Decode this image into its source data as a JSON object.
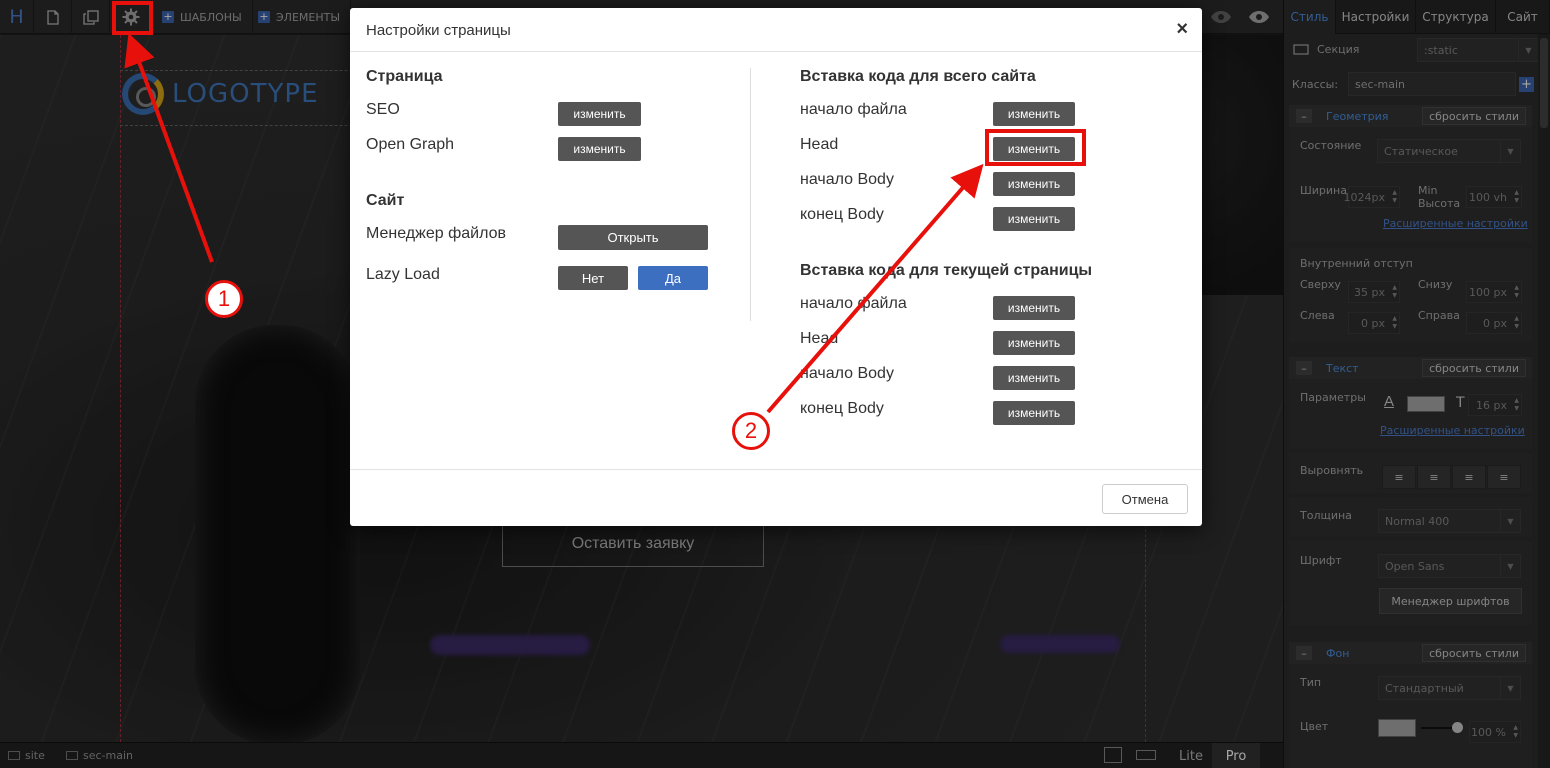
{
  "toolbar": {
    "logo_letter": "H",
    "templates_label": "ШАБЛОНЫ",
    "elements_label": "ЭЛЕМЕНТЫ"
  },
  "canvas": {
    "logo_text": "LOGOTYPE",
    "cta_label": "Оставить заявку"
  },
  "statusbar": {
    "crumb_site": "site",
    "crumb_section": "sec-main",
    "lite_label": "Lite",
    "pro_label": "Pro"
  },
  "panel": {
    "tabs": [
      "Стиль",
      "Настройки",
      "Структура",
      "Сайт"
    ],
    "section_label": "Секция",
    "section_value": ":static",
    "classes_label": "Классы:",
    "classes_value": "sec-main",
    "geometry": {
      "title": "Геометрия",
      "reset": "сбросить стили",
      "state_label": "Состояние",
      "state_value": "Статическое",
      "width_label": "Ширина",
      "width_value": "1024px",
      "minheight_label_1": "Min",
      "minheight_label_2": "Высота",
      "minheight_value": "100 vh",
      "advanced": "Расширенные настройки",
      "padding_label": "Внутренний отступ",
      "top_label": "Сверху",
      "top_value": "35",
      "bottom_label": "Снизу",
      "bottom_value": "100",
      "left_label": "Слева",
      "left_value": "0",
      "right_label": "Справа",
      "right_value": "0",
      "unit": "px"
    },
    "text": {
      "title": "Текст",
      "reset": "сбросить стили",
      "params_label": "Параметры",
      "font_size": "16",
      "unit": "px",
      "advanced": "Расширенные настройки",
      "align_label": "Выровнять",
      "weight_label": "Толщина",
      "weight_value": "Normal 400",
      "font_label": "Шрифт",
      "font_value": "Open Sans",
      "font_manager": "Менеджер шрифтов"
    },
    "background": {
      "title": "Фон",
      "reset": "сбросить стили",
      "type_label": "Тип",
      "type_value": "Стандартный",
      "color_label": "Цвет",
      "opacity_value": "100 %"
    }
  },
  "modal": {
    "title": "Настройки страницы",
    "page_section": "Страница",
    "seo_label": "SEO",
    "og_label": "Open Graph",
    "site_section": "Сайт",
    "file_manager_label": "Менеджер файлов",
    "open_button": "Открыть",
    "lazy_label": "Lazy Load",
    "no_button": "Нет",
    "yes_button": "Да",
    "edit_button": "изменить",
    "site_code_section": "Вставка кода для всего сайта",
    "page_code_section": "Вставка кода для текущей страницы",
    "file_start": "начало файла",
    "head": "Head",
    "body_start": "начало Body",
    "body_end": "конец Body",
    "cancel_button": "Отмена"
  },
  "annotations": {
    "step1": "1",
    "step2": "2",
    "color": "#e8100b"
  },
  "colors": {
    "accent_blue": "#3d6fc0",
    "panel_link": "#4d8fe0"
  }
}
